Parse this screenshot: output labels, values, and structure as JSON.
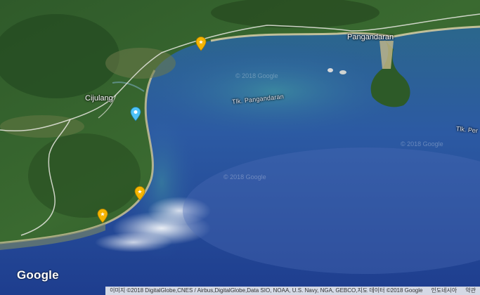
{
  "map": {
    "places": {
      "pangandaran": "Pangandaran",
      "cijulang": "Cijulang"
    },
    "water": {
      "bay_main": "Tlk. Pangandaran",
      "bay_right": "Tlk. Per"
    },
    "watermarks": [
      "© 2018 Google",
      "© 2018 Google",
      "© 2018 Google"
    ],
    "logo": "Google",
    "attribution": "이미지 ©2018 DigitalGlobe,CNES / Airbus,DigitalGlobe,Data SIO, NOAA, U.S. Navy, NGA, GEBCO,지도 데이터 ©2018 Google",
    "footer_links": {
      "country": "인도네시아",
      "terms": "약관"
    },
    "markers": [
      {
        "type": "star",
        "color": "#f5b400"
      },
      {
        "type": "star",
        "color": "#f5b400"
      },
      {
        "type": "star",
        "color": "#f5b400"
      },
      {
        "type": "pin",
        "color": "#4fc3f7"
      }
    ]
  }
}
